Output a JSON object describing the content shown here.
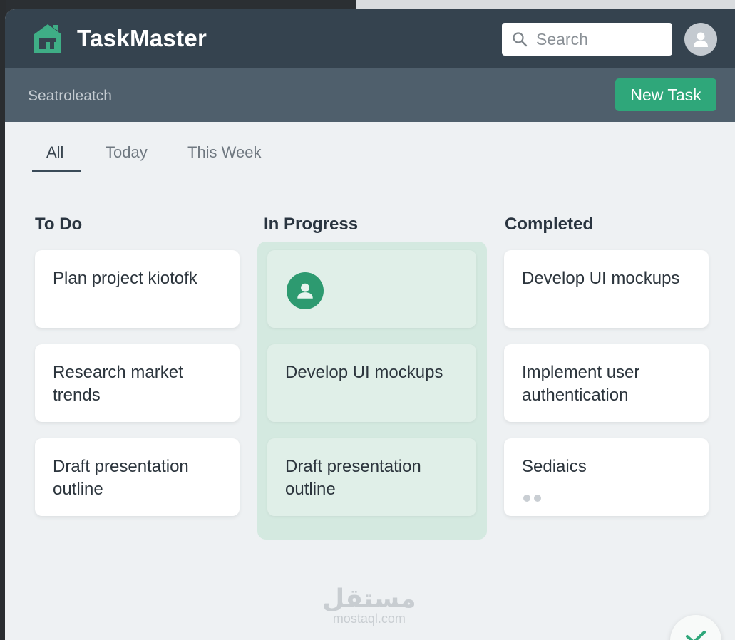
{
  "app": {
    "title": "TaskMaster"
  },
  "header": {
    "search_placeholder": "Search"
  },
  "subbar": {
    "text": "Seatroleatch",
    "new_task_label": "New Task"
  },
  "tabs": [
    {
      "label": "All",
      "active": true
    },
    {
      "label": "Today",
      "active": false
    },
    {
      "label": "This Week",
      "active": false
    }
  ],
  "columns": {
    "todo": {
      "title": "To Do",
      "cards": [
        {
          "text": "Plan project kiotofk"
        },
        {
          "text": "Research market trends"
        },
        {
          "text": "Draft presentation outline"
        }
      ]
    },
    "in_progress": {
      "title": "In Progress",
      "cards": [
        {
          "text": ""
        },
        {
          "text": "Develop UI mockups"
        },
        {
          "text": "Draft presentation outline"
        }
      ]
    },
    "completed": {
      "title": "Completed",
      "cards": [
        {
          "text": "Develop UI mockups"
        },
        {
          "text": "Implement user authentication"
        },
        {
          "text": "Sediaics"
        }
      ]
    }
  },
  "watermark": {
    "arabic": "مستقل",
    "latin": "mostaql.com"
  },
  "colors": {
    "topbar": "#35434f",
    "subbar": "#4f5f6c",
    "accent": "#2fa77a",
    "progress_panel": "#d4e9e0",
    "background": "#eef1f3"
  },
  "icons": {
    "logo": "house-logo-icon",
    "search": "search-icon",
    "avatar": "user-icon",
    "fab": "checkmark-icon"
  }
}
